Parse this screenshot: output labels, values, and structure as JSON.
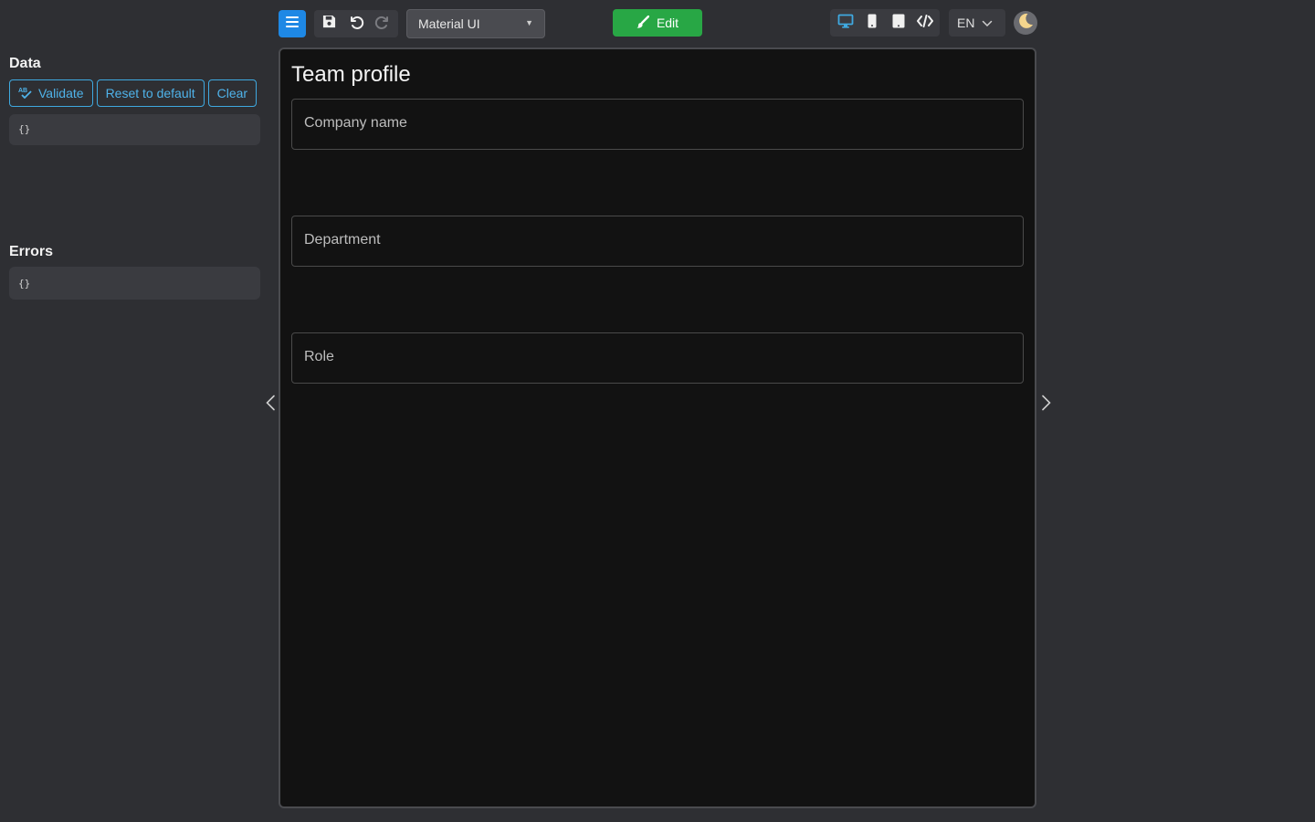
{
  "data_panel": {
    "title": "Data",
    "validate_label": "Validate",
    "reset_label": "Reset to default",
    "clear_label": "Clear",
    "data_json": "{}",
    "errors_title": "Errors",
    "errors_json": "{}"
  },
  "toolbar": {
    "theme_selected": "Material UI",
    "edit_label": "Edit",
    "language": "EN",
    "icons": {
      "menu": "menu-icon",
      "save": "save-icon",
      "undo": "undo-icon",
      "redo": "redo-icon",
      "desktop": "desktop-icon",
      "mobile": "mobile-icon",
      "tablet": "tablet-icon",
      "code": "code-icon",
      "theme_toggle": "moon-icon"
    }
  },
  "form": {
    "title": "Team profile",
    "fields": [
      {
        "label": "Company name",
        "value": ""
      },
      {
        "label": "Department",
        "value": ""
      },
      {
        "label": "Role",
        "value": ""
      }
    ]
  },
  "colors": {
    "accent": "#1e88e5",
    "edit": "#28a745",
    "outline": "#3fa9e0"
  }
}
